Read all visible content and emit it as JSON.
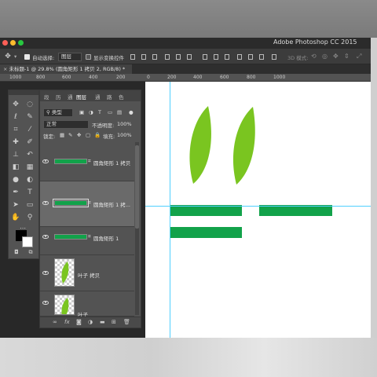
{
  "window": {
    "title": "Adobe Photoshop CC 2015",
    "traffic_lights": [
      "#fe5f57",
      "#febc2e",
      "#28c840"
    ]
  },
  "options_bar": {
    "auto_select_label": "自动选择:",
    "auto_select_value": "图层",
    "show_transform_label": "显示变换控件",
    "mode_3d_label": "3D 模式:"
  },
  "document": {
    "tab_title": "未标题-1 @ 29.8% (圆角矩形 1 拷贝 2, RGB/8) *"
  },
  "ruler": {
    "labels": [
      "1000",
      "800",
      "600",
      "400",
      "200",
      "0",
      "200",
      "400",
      "600",
      "800",
      "1000"
    ]
  },
  "layers_panel": {
    "tabs": [
      "段",
      "历",
      "通",
      "图层",
      "通",
      "路",
      "色"
    ],
    "active_tab": "图层",
    "filter_kind": "类型",
    "blend_mode": "正常",
    "opacity_label": "不透明度:",
    "opacity_value": "100%",
    "lock_label": "锁定:",
    "fill_label": "填充:",
    "fill_value": "100%",
    "layers": [
      {
        "name": "圆角矩形 1 拷贝",
        "type": "shape",
        "selected": false
      },
      {
        "name": "圆角矩形 1 拷...",
        "type": "shape",
        "selected": true
      },
      {
        "name": "圆角矩形 1",
        "type": "shape",
        "selected": false
      },
      {
        "name": "叶子 拷贝",
        "type": "pixel",
        "selected": false
      },
      {
        "name": "叶子",
        "type": "pixel",
        "selected": false
      }
    ],
    "footer_icons": [
      "link-icon",
      "fx-icon",
      "mask-icon",
      "adjustment-icon",
      "group-icon",
      "new-layer-icon",
      "trash-icon"
    ]
  },
  "colors": {
    "leaf_green": "#7ac520",
    "rect_green": "#12a24a",
    "guide_cyan": "#4fd0ff",
    "foreground": "#000000",
    "background": "#ffffff"
  }
}
